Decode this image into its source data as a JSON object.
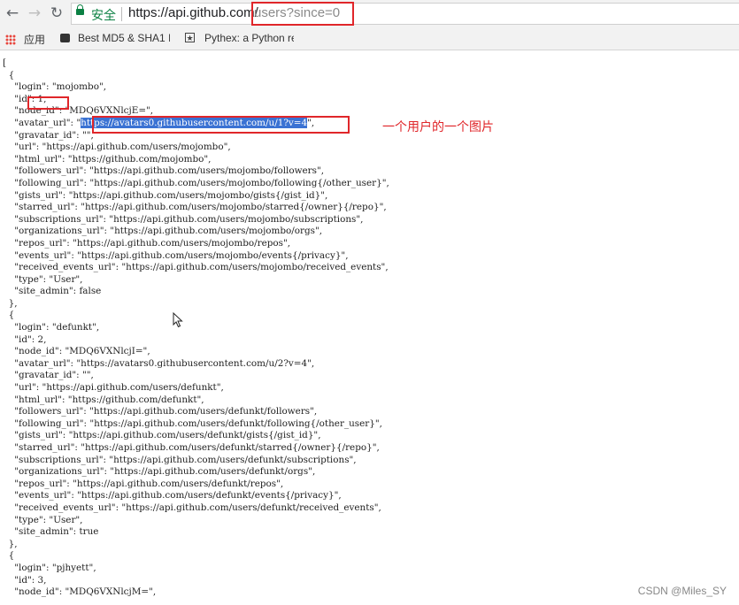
{
  "browser": {
    "secure_label": "安全",
    "url_host": "https://api.github.com/",
    "url_path": "users?since=0",
    "bookmarks": [
      {
        "label": "应用",
        "icon": "apps-grid-icon"
      },
      {
        "label": "Best MD5 & SHA1 I",
        "icon": "bookmark-favicon-icon"
      },
      {
        "label": "Pythex: a Python re",
        "icon": "pythex-favicon-icon"
      }
    ]
  },
  "json": {
    "u1": [
      "[",
      "  {",
      "    \"login\": \"mojombo\",",
      "    \"id\": 1,",
      "    \"node_id\": \"MDQ6VXNlcjE=\",",
      "    \"avatar_url\": \"",
      "https://avatars0.githubusercontent.com/u/1?v=4",
      "\",",
      "    \"gravatar_id\": \"\",",
      "    \"url\": \"https://api.github.com/users/mojombo\",",
      "    \"html_url\": \"https://github.com/mojombo\",",
      "    \"followers_url\": \"https://api.github.com/users/mojombo/followers\",",
      "    \"following_url\": \"https://api.github.com/users/mojombo/following{/other_user}\",",
      "    \"gists_url\": \"https://api.github.com/users/mojombo/gists{/gist_id}\",",
      "    \"starred_url\": \"https://api.github.com/users/mojombo/starred{/owner}{/repo}\",",
      "    \"subscriptions_url\": \"https://api.github.com/users/mojombo/subscriptions\",",
      "    \"organizations_url\": \"https://api.github.com/users/mojombo/orgs\",",
      "    \"repos_url\": \"https://api.github.com/users/mojombo/repos\",",
      "    \"events_url\": \"https://api.github.com/users/mojombo/events{/privacy}\",",
      "    \"received_events_url\": \"https://api.github.com/users/mojombo/received_events\",",
      "    \"type\": \"User\",",
      "    \"site_admin\": false",
      "  },"
    ],
    "u2": [
      "  {",
      "    \"login\": \"defunkt\",",
      "    \"id\": 2,",
      "    \"node_id\": \"MDQ6VXNlcjI=\",",
      "    \"avatar_url\": \"https://avatars0.githubusercontent.com/u/2?v=4\",",
      "    \"gravatar_id\": \"\",",
      "    \"url\": \"https://api.github.com/users/defunkt\",",
      "    \"html_url\": \"https://github.com/defunkt\",",
      "    \"followers_url\": \"https://api.github.com/users/defunkt/followers\",",
      "    \"following_url\": \"https://api.github.com/users/defunkt/following{/other_user}\",",
      "    \"gists_url\": \"https://api.github.com/users/defunkt/gists{/gist_id}\",",
      "    \"starred_url\": \"https://api.github.com/users/defunkt/starred{/owner}{/repo}\",",
      "    \"subscriptions_url\": \"https://api.github.com/users/defunkt/subscriptions\",",
      "    \"organizations_url\": \"https://api.github.com/users/defunkt/orgs\",",
      "    \"repos_url\": \"https://api.github.com/users/defunkt/repos\",",
      "    \"events_url\": \"https://api.github.com/users/defunkt/events{/privacy}\",",
      "    \"received_events_url\": \"https://api.github.com/users/defunkt/received_events\",",
      "    \"type\": \"User\",",
      "    \"site_admin\": true",
      "  },"
    ],
    "u3": [
      "  {",
      "    \"login\": \"pjhyett\",",
      "    \"id\": 3,",
      "    \"node_id\": \"MDQ6VXNlcjM=\","
    ]
  },
  "annotation_text": "一个用户的一个图片",
  "watermark": "CSDN @Miles_SY",
  "colors": {
    "highlight_box": "#e0262a",
    "selection": "#3a72d3",
    "secure_green": "#0b8043"
  }
}
